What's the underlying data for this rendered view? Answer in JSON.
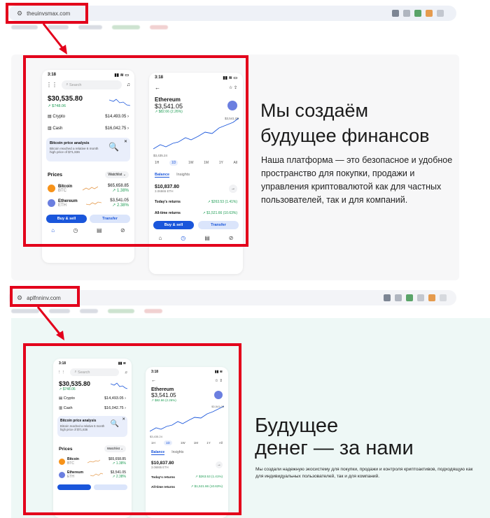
{
  "top": {
    "url": "theuinvsmax.com",
    "hero_title_line1": "Мы создаём",
    "hero_title_line2": "будущее финансов",
    "hero_body": "Наша платформа — это безопасное и удобное пространство для покупки, продажи и управления криптовалютой как для частных пользователей, так и для компаний."
  },
  "bottom": {
    "url": "aplfnninv.com",
    "hero_title_line1": "Будущее",
    "hero_title_line2": "денег — за нами",
    "hero_body": "Мы создали надежную экосистему для покупки, продажи и контроля криптоактивов, подходящую как для индивидуальных пользователей, так и для компаний."
  },
  "phone_left": {
    "time": "3:18",
    "search_placeholder": "Search",
    "balance": "$30,535.80",
    "change": "↗ $748.06",
    "crypto_label": "Crypto",
    "crypto_value": "$14,493.05",
    "cash_label": "Cash",
    "cash_value": "$16,042.75",
    "analysis_title": "Bitcoin price analysis",
    "analysis_text": "Bitcoin reached a relative 6 month high price of $71,836",
    "prices_label": "Prices",
    "watchlist_label": "Watchlist ⌄",
    "btc_name": "Bitcoin",
    "btc_ticker": "BTC",
    "btc_price": "$65,658.85",
    "btc_change": "↗ 1.38%",
    "eth_name": "Ethereum",
    "eth_ticker": "ETH",
    "eth_price": "$3,541.05",
    "eth_change": "↗ 2.38%",
    "buy_sell": "Buy & sell",
    "transfer": "Transfer"
  },
  "phone_right": {
    "time": "3:18",
    "asset": "Ethereum",
    "price": "$3,541.05",
    "change": "↗ $82.66 (2.26%)",
    "chart_high": "$3,541.05",
    "chart_low": "$3,435.24",
    "ranges": [
      "1H",
      "1D",
      "1W",
      "1M",
      "1Y",
      "All"
    ],
    "tab_balance": "Balance",
    "tab_insights": "Insights",
    "holding_value": "$10,837.80",
    "holding_amount": "3.06865 ETH",
    "todays_returns_label": "Today's returns",
    "todays_returns_value": "↗ $263.53 (1.41%)",
    "alltime_label": "All-time returns",
    "alltime_value": "↗ $1,521.66 (10.63%)",
    "buy_sell": "Buy & sell",
    "transfer": "Transfer"
  },
  "colors": {
    "highlight": "#e3001b",
    "accent": "#1a56db",
    "positive": "#1f9d55"
  }
}
